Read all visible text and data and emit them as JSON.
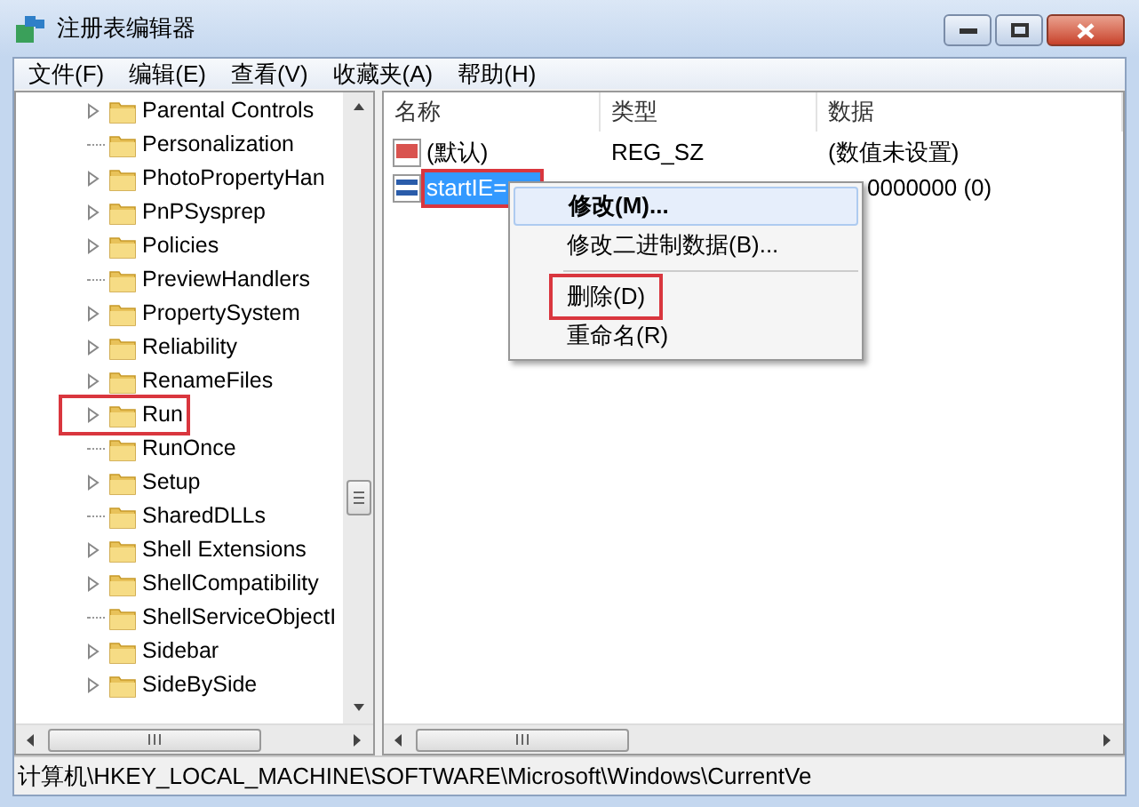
{
  "window": {
    "title": "注册表编辑器"
  },
  "menu": [
    "文件(F)",
    "编辑(E)",
    "查看(V)",
    "收藏夹(A)",
    "帮助(H)"
  ],
  "tree": [
    {
      "label": "Parental Controls",
      "expandable": true,
      "highlighted": false
    },
    {
      "label": "Personalization",
      "expandable": false,
      "highlighted": false
    },
    {
      "label": "PhotoPropertyHan",
      "expandable": true,
      "highlighted": false
    },
    {
      "label": "PnPSysprep",
      "expandable": true,
      "highlighted": false
    },
    {
      "label": "Policies",
      "expandable": true,
      "highlighted": false
    },
    {
      "label": "PreviewHandlers",
      "expandable": false,
      "highlighted": false
    },
    {
      "label": "PropertySystem",
      "expandable": true,
      "highlighted": false
    },
    {
      "label": "Reliability",
      "expandable": true,
      "highlighted": false
    },
    {
      "label": "RenameFiles",
      "expandable": true,
      "highlighted": false
    },
    {
      "label": "Run",
      "expandable": true,
      "highlighted": true
    },
    {
      "label": "RunOnce",
      "expandable": false,
      "highlighted": false
    },
    {
      "label": "Setup",
      "expandable": true,
      "highlighted": false
    },
    {
      "label": "SharedDLLs",
      "expandable": false,
      "highlighted": false
    },
    {
      "label": "Shell Extensions",
      "expandable": true,
      "highlighted": false
    },
    {
      "label": "ShellCompatibility",
      "expandable": true,
      "highlighted": false
    },
    {
      "label": "ShellServiceObjectI",
      "expandable": false,
      "highlighted": false
    },
    {
      "label": "Sidebar",
      "expandable": true,
      "highlighted": false
    },
    {
      "label": "SideBySide",
      "expandable": true,
      "highlighted": false
    }
  ],
  "table": {
    "columns": [
      "名称",
      "类型",
      "数据"
    ],
    "rows": [
      {
        "kind": "string",
        "name": "(默认)",
        "type": "REG_SZ",
        "data": "(数值未设置)",
        "selected": false,
        "highlighted": false
      },
      {
        "kind": "binary",
        "name": "startIE=",
        "data": "0000000 (0)",
        "selected": true,
        "highlighted": true
      }
    ]
  },
  "context_menu": [
    {
      "kind": "item",
      "label": "修改(M)...",
      "default": true,
      "hovered": true,
      "highlighted": false
    },
    {
      "kind": "item",
      "label": "修改二进制数据(B)...",
      "default": false,
      "hovered": false,
      "highlighted": false
    },
    {
      "kind": "separator"
    },
    {
      "kind": "item",
      "label": "删除(D)",
      "default": false,
      "hovered": false,
      "highlighted": true
    },
    {
      "kind": "item",
      "label": "重命名(R)",
      "default": false,
      "hovered": false,
      "highlighted": false
    }
  ],
  "status_bar": "计算机\\HKEY_LOCAL_MACHINE\\SOFTWARE\\Microsoft\\Windows\\CurrentVe"
}
